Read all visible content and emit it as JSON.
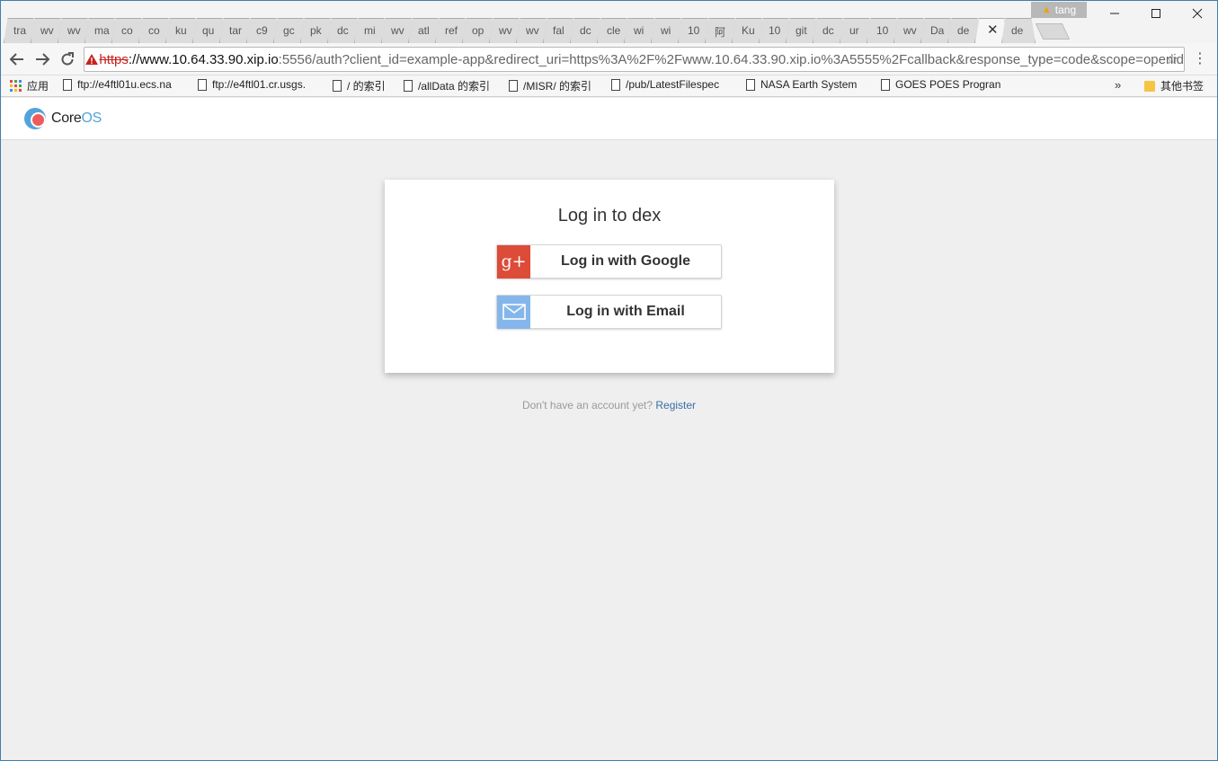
{
  "browser": {
    "tabs": [
      "tra",
      "wv",
      "wv",
      "ma",
      "co",
      "co",
      "ku",
      "qu",
      "tar",
      "c9",
      "gc",
      "pk",
      "dc",
      "mi",
      "wv",
      "atl",
      "ref",
      "op",
      "wv",
      "wv",
      "fal",
      "dc",
      "cle",
      "wi",
      "wi",
      "10",
      "阿",
      "Ku",
      "10",
      "git",
      "dc",
      "ur",
      "10",
      "wv",
      "Da",
      "de"
    ],
    "active_tab_close": "✕",
    "trailing_tab": "de",
    "profile_name": "tang",
    "address": {
      "scheme": "https",
      "host": "://www.10.64.33.90.xip.io",
      "rest": ":5556/auth?client_id=example-app&redirect_uri=https%3A%2F%2Fwww.10.64.33.90.xip.io%3A5555%2Fcallback&response_type=code&scope=openid"
    },
    "bookmarks": {
      "apps": "应用",
      "items": [
        "ftp://e4ftl01u.ecs.na",
        "ftp://e4ftl01.cr.usgs.",
        "/ 的索引",
        "/allData 的索引",
        "/MISR/ 的索引",
        "/pub/LatestFilespec",
        "NASA Earth System",
        "GOES POES Progran"
      ],
      "overflow": "»",
      "other": "其他书签"
    }
  },
  "page": {
    "logo": {
      "core": "Core",
      "os": "OS"
    },
    "card_title": "Log in to dex",
    "google_label": "Log in with Google",
    "email_label": "Log in with Email",
    "register_prompt": "Don't have an account yet?",
    "register_link": "Register"
  },
  "colors": {
    "google": "#dd4b39",
    "email": "#84b6eb",
    "link": "#3a6ea5",
    "background": "#efefef"
  }
}
